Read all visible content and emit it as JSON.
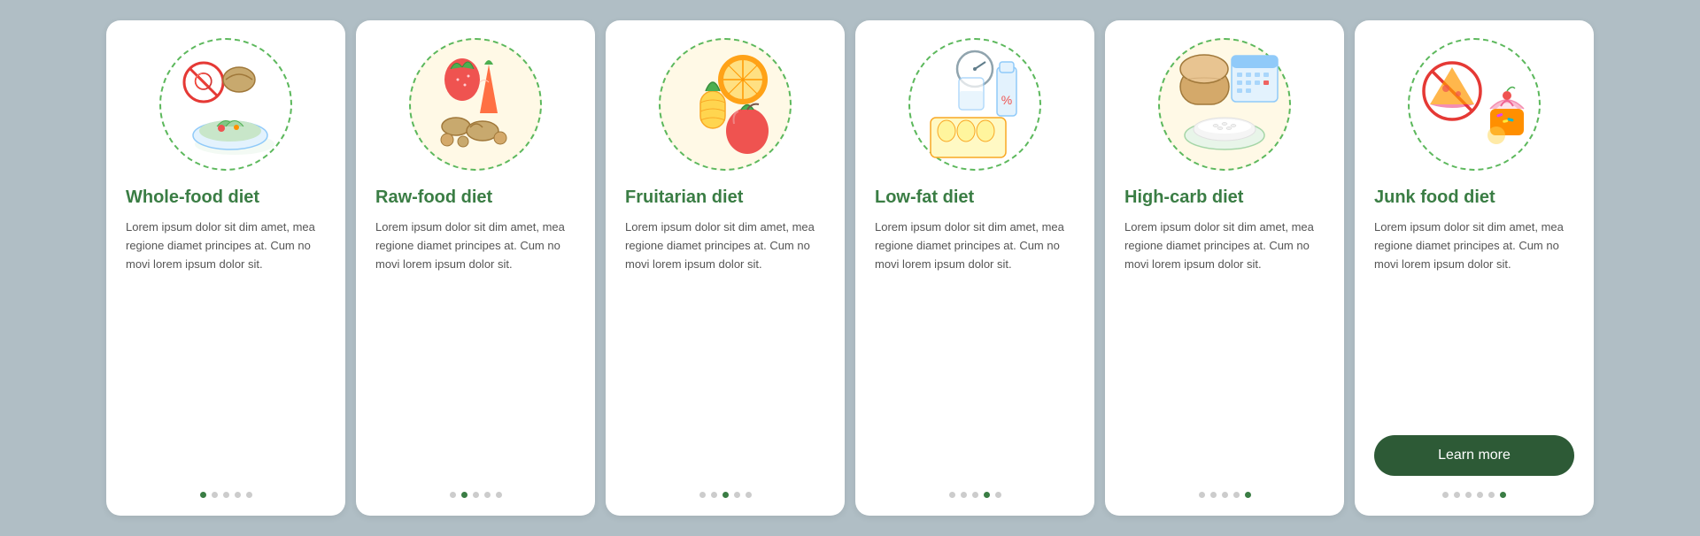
{
  "cards": [
    {
      "id": "whole-food",
      "title": "Whole-food diet",
      "text": "Lorem ipsum dolor sit dim amet, mea regione diamet principes at. Cum no movi lorem ipsum dolor sit.",
      "dots": [
        true,
        false,
        false,
        false,
        false
      ],
      "active_dot": 0,
      "icon_type": "whole-food"
    },
    {
      "id": "raw-food",
      "title": "Raw-food diet",
      "text": "Lorem ipsum dolor sit dim amet, mea regione diamet principes at. Cum no movi lorem ipsum dolor sit.",
      "dots": [
        false,
        true,
        false,
        false,
        false
      ],
      "active_dot": 1,
      "icon_type": "raw-food"
    },
    {
      "id": "fruitarian",
      "title": "Fruitarian diet",
      "text": "Lorem ipsum dolor sit dim amet, mea regione diamet principes at. Cum no movi lorem ipsum dolor sit.",
      "dots": [
        false,
        false,
        true,
        false,
        false
      ],
      "active_dot": 2,
      "icon_type": "fruitarian"
    },
    {
      "id": "low-fat",
      "title": "Low-fat diet",
      "text": "Lorem ipsum dolor sit dim amet, mea regione diamet principes at. Cum no movi lorem ipsum dolor sit.",
      "dots": [
        false,
        false,
        false,
        true,
        false
      ],
      "active_dot": 3,
      "icon_type": "low-fat"
    },
    {
      "id": "high-carb",
      "title": "High-carb diet",
      "text": "Lorem ipsum dolor sit dim amet, mea regione diamet principes at. Cum no movi lorem ipsum dolor sit.",
      "dots": [
        false,
        false,
        false,
        false,
        true
      ],
      "active_dot": 4,
      "icon_type": "high-carb"
    },
    {
      "id": "junk-food",
      "title": "Junk food diet",
      "text": "Lorem ipsum dolor sit dim amet, mea regione diamet principes at. Cum no movi lorem ipsum dolor sit.",
      "dots": [
        false,
        false,
        false,
        false,
        false,
        true
      ],
      "active_dot": 5,
      "icon_type": "junk-food",
      "has_button": true,
      "button_label": "Learn more"
    }
  ],
  "icons": {
    "whole-food": "🥗",
    "raw-food": "🍓",
    "fruitarian": "🍍",
    "low-fat": "🥚",
    "high-carb": "🍞",
    "junk-food": "🍕"
  }
}
